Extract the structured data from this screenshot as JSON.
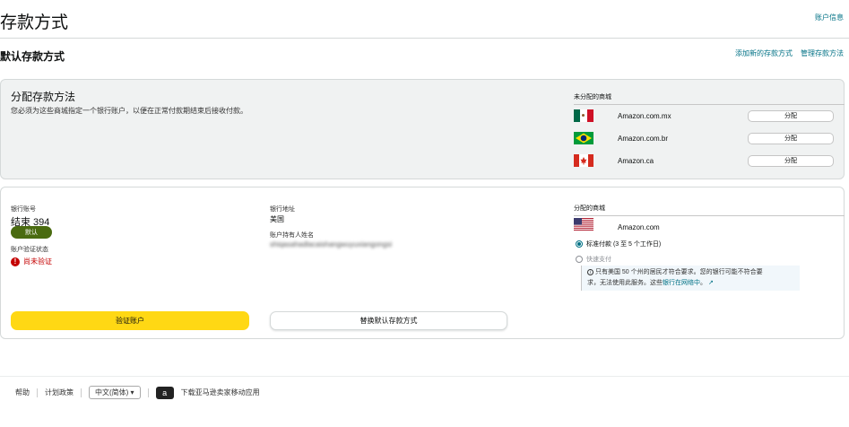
{
  "header": {
    "title": "存款方式",
    "account_info": "账户信息"
  },
  "section": {
    "title": "默认存款方式",
    "add_link": "添加新的存款方式",
    "manage_link": "管理存款方法"
  },
  "assign_card": {
    "title": "分配存款方法",
    "description": "您必须为这些商城指定一个银行账户，以便在正常付款期结束后接收付款。",
    "unassigned_header": "未分配的商城",
    "marketplaces": [
      {
        "name": "Amazon.com.mx",
        "flag": "mexico-flag",
        "button": "分配"
      },
      {
        "name": "Amazon.com.br",
        "flag": "brazil-flag",
        "button": "分配"
      },
      {
        "name": "Amazon.ca",
        "flag": "canada-flag",
        "button": "分配"
      }
    ]
  },
  "bank_card": {
    "account_label": "银行账号",
    "account_value": "结束 394",
    "default_badge": "默认",
    "verify_status_label": "账户验证状态",
    "verify_status_value": "尚未验证",
    "address_label": "银行地址",
    "address_value": "美国",
    "holder_label": "账户持有人姓名",
    "holder_value": "shiqasahadlacaishangwuyuxiangongsi",
    "assigned_header": "分配的商城",
    "assigned_market": "Amazon.com",
    "radio_standard": "标准付款 (3 至 5 个工作日)",
    "radio_fast": "快速支付",
    "notice_line1": "只有美国 50 个州的居民才符合要求。您的银行可能不符合要",
    "notice_line2_prefix": "求，无法使用此服务。这些",
    "notice_link": "银行在网络中",
    "notice_line2_suffix": "。",
    "verify_button": "验证账户",
    "replace_button": "替换默认存款方式"
  },
  "footer": {
    "help": "帮助",
    "policies": "计划政策",
    "language": "中文(简体)",
    "app_text": "下载亚马逊卖家移动应用"
  },
  "colors": {
    "link": "#007185",
    "primary_button": "#ffd814",
    "default_badge": "#4a6b10",
    "warning": "#c40000"
  }
}
